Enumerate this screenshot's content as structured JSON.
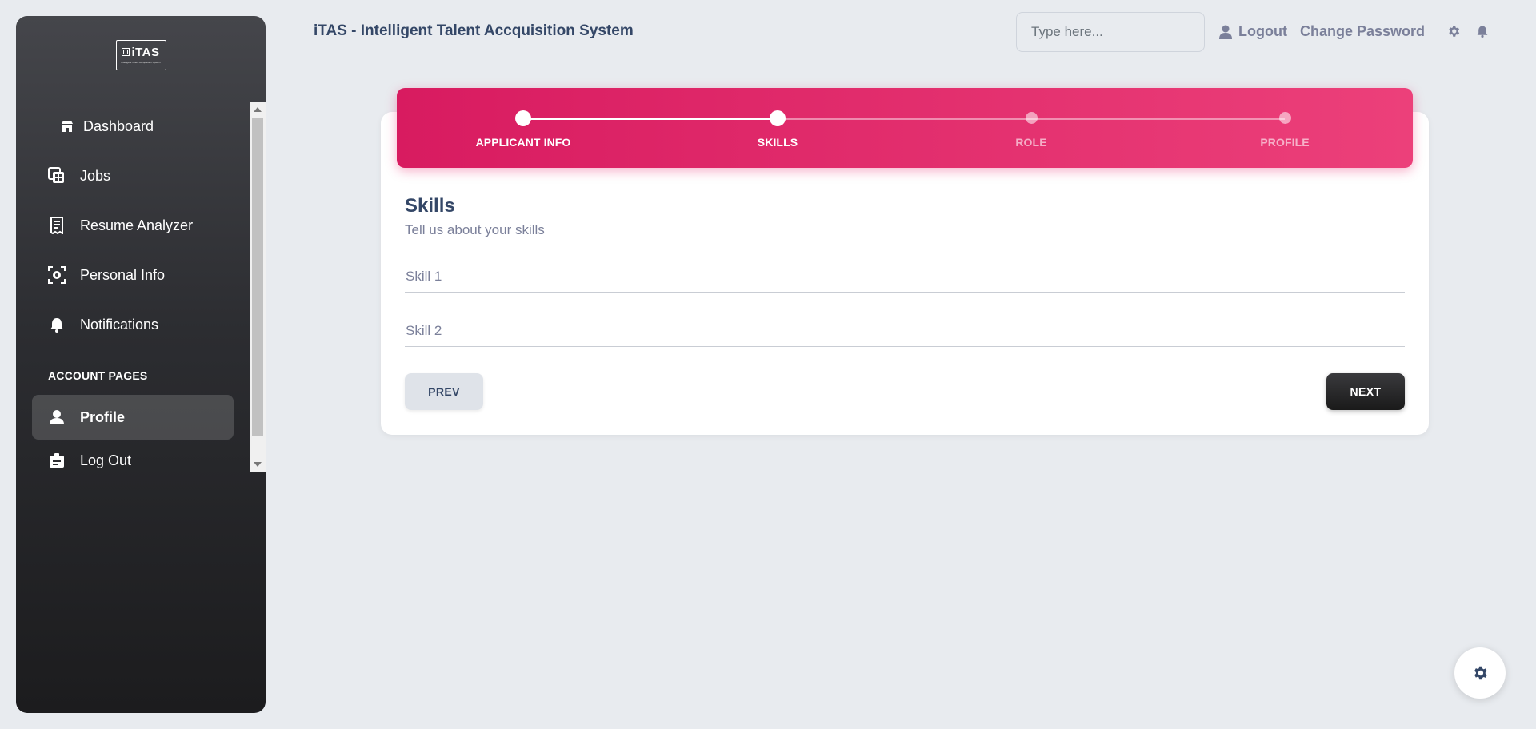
{
  "app": {
    "title": "iTAS - Intelligent Talent Accquisition System"
  },
  "logo": {
    "text": "iTAS",
    "subtext": "Intelligent Talent Accquisition System"
  },
  "sidebar": {
    "items": [
      {
        "label": "Dashboard",
        "icon": "store-icon"
      },
      {
        "label": "Jobs",
        "icon": "stack-icon"
      },
      {
        "label": "Resume Analyzer",
        "icon": "receipt-icon"
      },
      {
        "label": "Personal Info",
        "icon": "target-icon"
      },
      {
        "label": "Notifications",
        "icon": "bell-icon"
      }
    ],
    "section_label": "ACCOUNT PAGES",
    "account_items": [
      {
        "label": "Profile",
        "icon": "person-icon",
        "active": true
      },
      {
        "label": "Log Out",
        "icon": "badge-icon"
      }
    ]
  },
  "header": {
    "search_placeholder": "Type here...",
    "logout_label": "Logout",
    "change_password_label": "Change Password"
  },
  "stepper": {
    "steps": [
      {
        "label": "APPLICANT INFO",
        "state": "done"
      },
      {
        "label": "SKILLS",
        "state": "current"
      },
      {
        "label": "ROLE",
        "state": "todo"
      },
      {
        "label": "PROFILE",
        "state": "todo"
      }
    ]
  },
  "form": {
    "title": "Skills",
    "subtitle": "Tell us about your skills",
    "fields": [
      {
        "placeholder": "Skill 1",
        "value": ""
      },
      {
        "placeholder": "Skill 2",
        "value": ""
      }
    ],
    "prev_label": "PREV",
    "next_label": "NEXT"
  },
  "colors": {
    "accent": "#e91e63",
    "dark": "#1a1a1a",
    "text": "#344767",
    "muted": "#7b809a"
  }
}
